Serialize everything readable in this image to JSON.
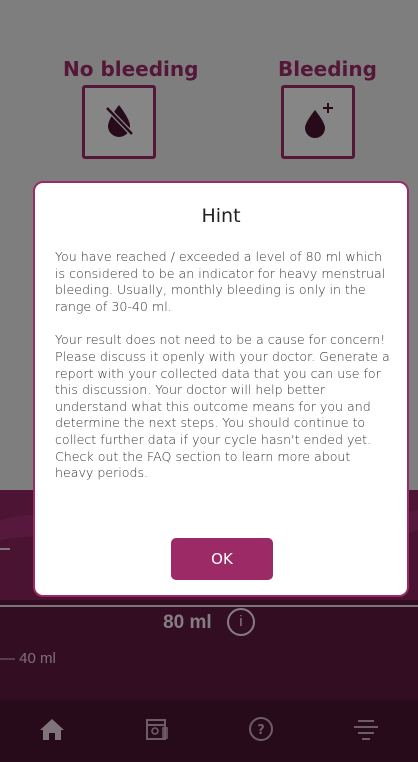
{
  "options": {
    "no_bleeding_label": "No bleeding",
    "bleeding_label": "Bleeding",
    "no_bleeding_icon": "crossed-drop-icon",
    "bleeding_icon": "drop-plus-icon"
  },
  "measurement": {
    "threshold_label": "80 ml",
    "info_glyph": "i",
    "tick_40_label": "— 40 ml"
  },
  "dialog": {
    "title": "Hint",
    "paragraph_1": "You have reached / exceeded a level of 80 ml which is considered to be an indicator for heavy menstrual bleeding. Usually, monthly bleeding is only in the range of 30-40 ml.",
    "paragraph_2": "Your result does not need to be a cause for concern! Please discuss it openly with your doctor. Generate a report with your collected data that you can use for this discussion. Your doctor will help better understand what this outcome means for you and determine the next steps. You should continue to collect further data if your cycle hasn't ended yet. Check out the FAQ section to learn more about heavy periods.",
    "ok_label": "OK"
  },
  "nav": {
    "items": [
      {
        "icon": "home-icon"
      },
      {
        "icon": "calendar-icon"
      },
      {
        "icon": "help-icon"
      },
      {
        "icon": "menu-icon"
      }
    ]
  },
  "colors": {
    "accent": "#9b2a66",
    "dark_plum": "#4a1431",
    "overlay": "rgba(0,0,0,0.45)"
  }
}
